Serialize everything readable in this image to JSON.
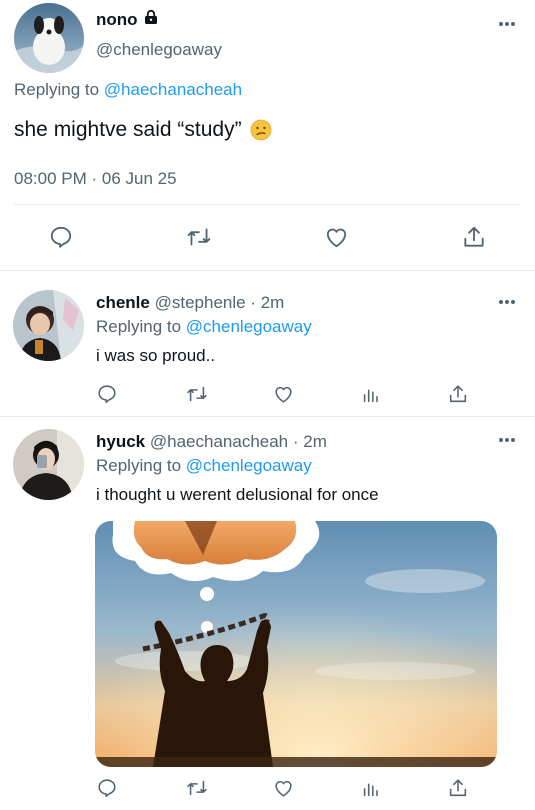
{
  "main_tweet": {
    "name": "nono",
    "handle": "@chenlegoaway",
    "replying_label": "Replying to",
    "replying_to": "@haechanacheah",
    "text": "she mightve said “study”",
    "emoji": "😕",
    "timestamp": "08:00 PM · 06 Jun 25",
    "icons": [
      "lock-icon",
      "more-icon",
      "reply-icon",
      "retweet-icon",
      "like-icon",
      "share-icon"
    ]
  },
  "replies": [
    {
      "name": "chenle",
      "handle": "@stephenle",
      "time": "· 2m",
      "replying_label": "Replying to",
      "replying_to": "@chenlegoaway",
      "text": "i was so proud.."
    },
    {
      "name": "hyuck",
      "handle": "@haechanacheah",
      "time": "· 2m",
      "replying_label": "Replying to",
      "replying_to": "@chenlegoaway",
      "text": "i thought u werent delusional for once"
    }
  ],
  "colors": {
    "link": "#1d9bf0",
    "muted": "#536471",
    "divider": "#e6ecf0"
  }
}
